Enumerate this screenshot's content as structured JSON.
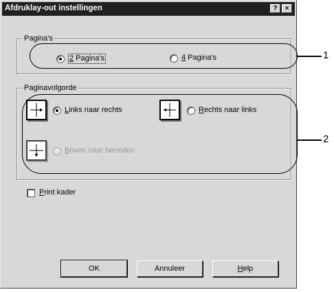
{
  "dialog": {
    "title": "Afdruklay-out instellingen",
    "help_glyph": "?",
    "close_glyph": "×"
  },
  "pages_group": {
    "label": "Pagina's",
    "options": [
      {
        "mnemonic": "2",
        "rest": " Pagina's",
        "checked": true
      },
      {
        "mnemonic": "4",
        "rest": " Pagina's",
        "checked": false
      }
    ]
  },
  "order_group": {
    "label": "Paginavolgorde",
    "options": [
      {
        "mnemonic": "L",
        "rest": "inks naar rechts",
        "checked": true,
        "disabled": false,
        "icon": "left-to-right-order-icon"
      },
      {
        "mnemonic": "R",
        "rest": "echts naar links",
        "checked": false,
        "disabled": false,
        "icon": "right-to-left-order-icon"
      },
      {
        "mnemonic": "B",
        "rest": "oven naar beneden",
        "checked": false,
        "disabled": true,
        "icon": "top-to-bottom-order-icon"
      }
    ]
  },
  "print_frames": {
    "mnemonic": "P",
    "rest": "rint kader",
    "checked": false
  },
  "buttons": {
    "ok": "OK",
    "cancel": "Annuleer",
    "help_mnemonic": "H",
    "help_rest": "elp"
  },
  "callouts": {
    "one": "1",
    "two": "2"
  }
}
